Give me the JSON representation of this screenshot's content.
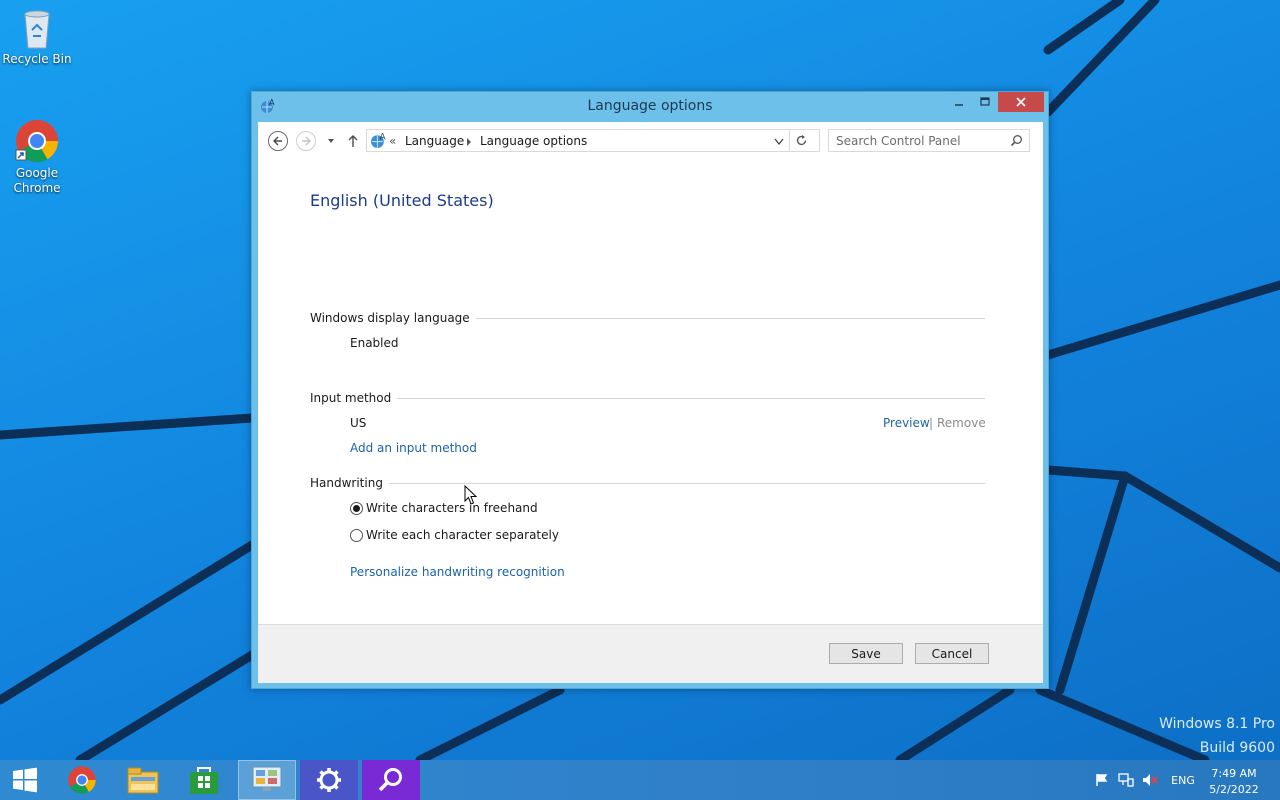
{
  "desktop": {
    "icons": [
      {
        "label": "Recycle Bin",
        "icon": "recycle-bin-icon"
      },
      {
        "label": "Google Chrome",
        "icon": "chrome-icon"
      }
    ],
    "watermark": {
      "line1": "Windows 8.1 Pro",
      "line2": "Build 9600"
    }
  },
  "window": {
    "title": "Language options",
    "address": {
      "overflow": "«",
      "crumbs": [
        "Language",
        "Language options"
      ]
    },
    "search": {
      "placeholder": "Search Control Panel"
    },
    "content": {
      "language_name": "English (United States)",
      "display_language": {
        "heading": "Windows display language",
        "value": "Enabled"
      },
      "input_method": {
        "heading": "Input method",
        "method": "US",
        "preview": "Preview",
        "separator": "|",
        "remove": "Remove",
        "add": "Add an input method"
      },
      "handwriting": {
        "heading": "Handwriting",
        "options": [
          {
            "label": "Write characters in freehand",
            "checked": true
          },
          {
            "label": "Write each character separately",
            "checked": false
          }
        ],
        "personalize": "Personalize handwriting recognition"
      }
    },
    "footer": {
      "save": "Save",
      "cancel": "Cancel"
    }
  },
  "taskbar": {
    "items": [
      {
        "name": "start-button",
        "icon": "windows-logo-icon"
      },
      {
        "name": "taskbar-chrome",
        "icon": "chrome-icon"
      },
      {
        "name": "taskbar-file-explorer",
        "icon": "folder-icon"
      },
      {
        "name": "taskbar-store",
        "icon": "store-icon"
      },
      {
        "name": "taskbar-control-panel",
        "icon": "control-panel-icon",
        "active": true
      },
      {
        "name": "taskbar-settings",
        "icon": "gear-icon"
      },
      {
        "name": "taskbar-search",
        "icon": "search-icon"
      }
    ],
    "tray": {
      "language": "ENG",
      "time": "7:49 AM",
      "date": "5/2/2022"
    }
  },
  "colors": {
    "accent": "#1d63a8",
    "close": "#c74a4a",
    "title_bar": "#6cc0ea"
  }
}
